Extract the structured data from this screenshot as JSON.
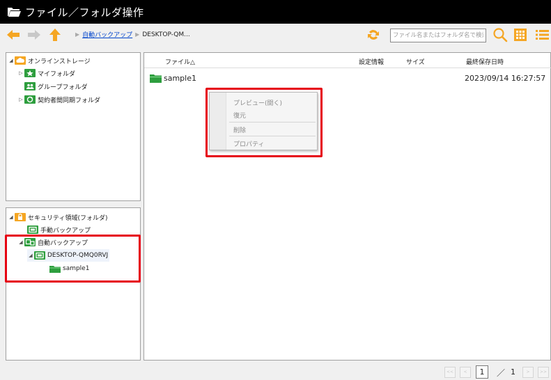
{
  "window": {
    "title": "ファイル／フォルダ操作"
  },
  "toolbar": {
    "breadcrumb": [
      "自動バックアップ",
      "DESKTOP-QM..."
    ],
    "search_placeholder": "ファイル名またはフォルダ名で検索"
  },
  "tree_top": {
    "root": "オンラインストレージ",
    "items": [
      "マイフォルダ",
      "グループフォルダ",
      "契約者間同期フォルダ"
    ]
  },
  "tree_bottom": {
    "root": "セキュリティ領域(フォルダ)",
    "manual": "手動バックアップ",
    "auto": "自動バックアップ",
    "device": "DESKTOP-QMQ0RVJ",
    "folder": "sample1"
  },
  "table": {
    "headers": {
      "name": "ファイル△",
      "settings": "設定情報",
      "size": "サイズ",
      "modified": "最終保存日時"
    },
    "rows": [
      {
        "name": "sample1",
        "modified": "2023/09/14 16:27:57"
      }
    ]
  },
  "context_menu": {
    "items": [
      "プレビュー(開く)",
      "復元",
      "削除",
      "プロパティ"
    ]
  },
  "pagination": {
    "current": "1",
    "separator": "／",
    "total": "1",
    "first": "<<",
    "prev": "<",
    "next": ">",
    "last": ">>"
  },
  "colors": {
    "accent_orange": "#f5a623",
    "highlight_red": "#e60012",
    "folder_green": "#2e9e3e",
    "link_blue": "#0044cc"
  }
}
